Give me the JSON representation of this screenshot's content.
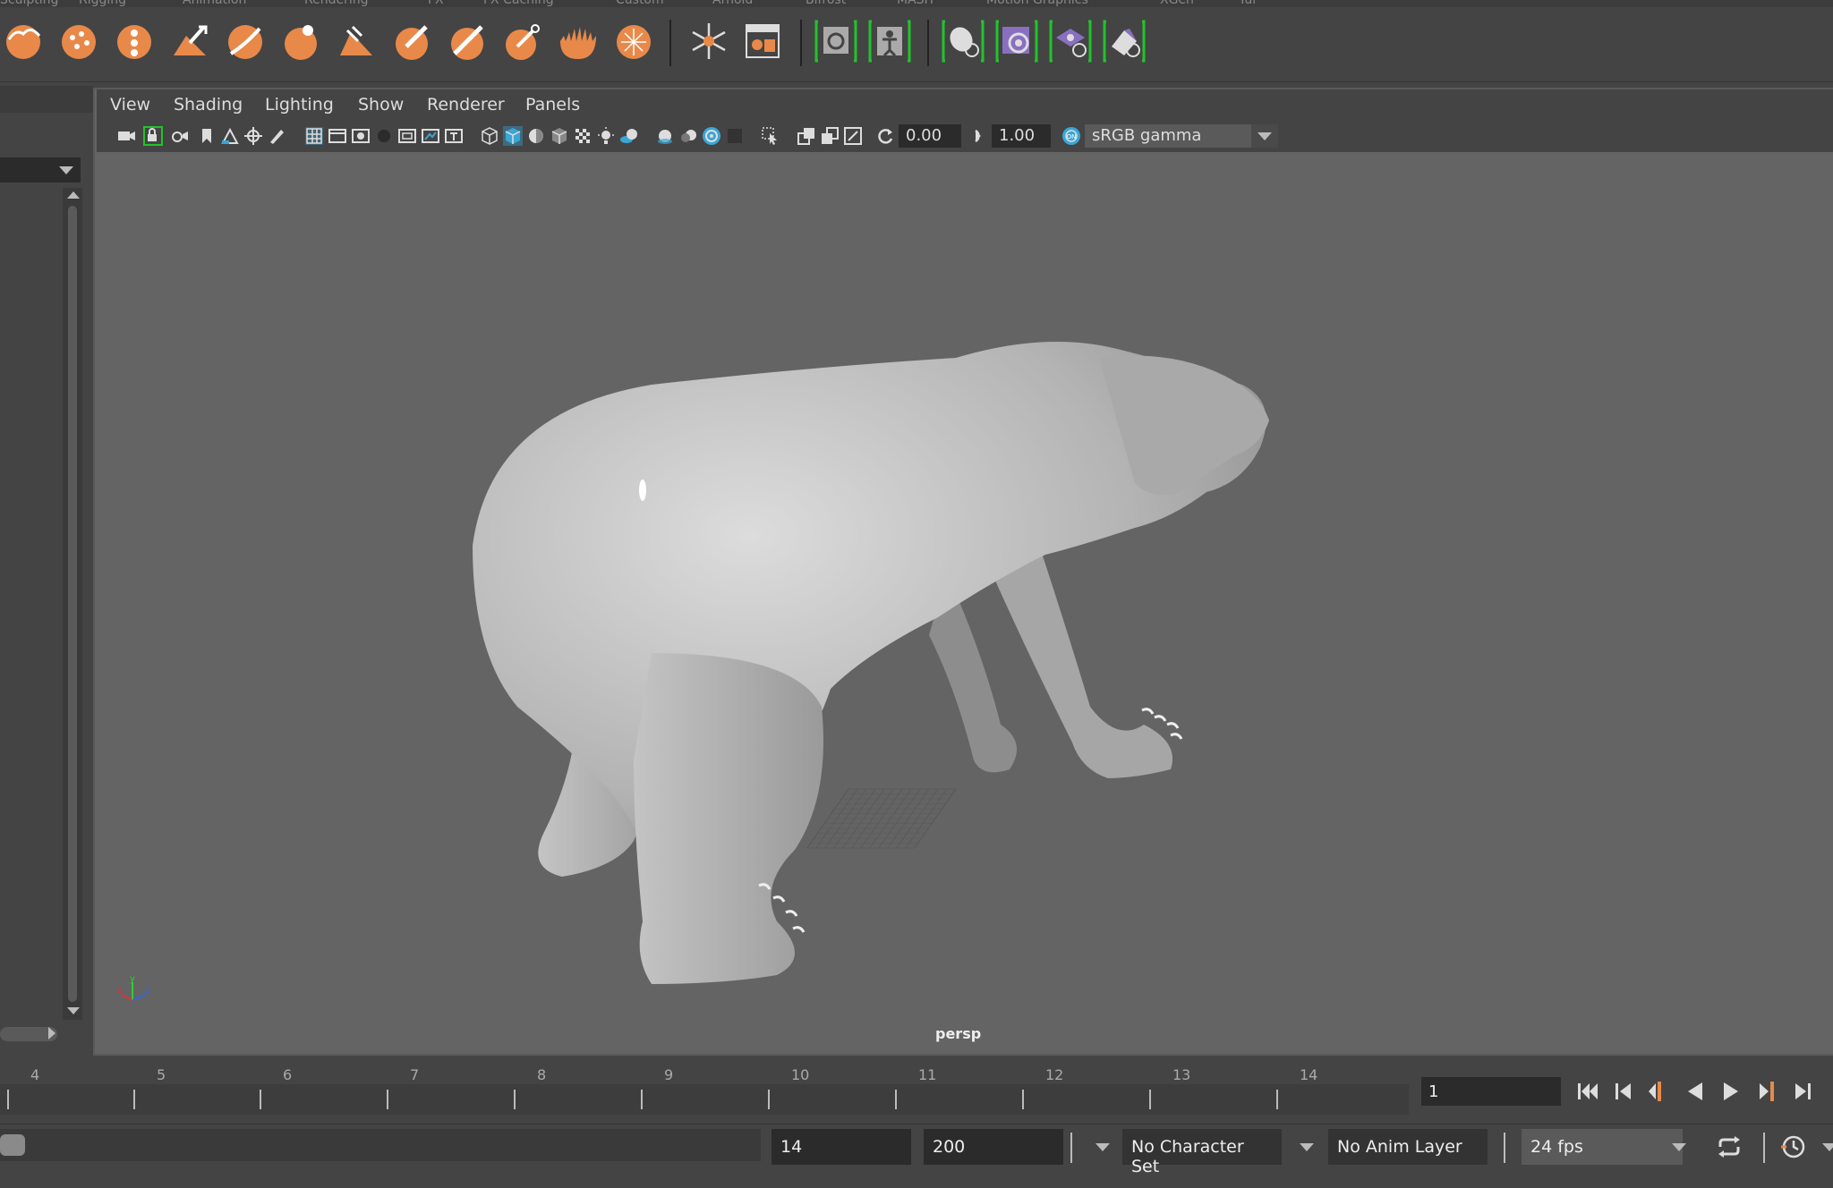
{
  "shelf_tabs": [
    "Sculpting",
    "Rigging",
    "Animation",
    "Rendering",
    "FX",
    "FX Caching",
    "Custom",
    "Arnold",
    "Bifrost",
    "MASH",
    "Motion Graphics",
    "XGen",
    "Tur"
  ],
  "viewport_menu": {
    "view": "View",
    "shading": "Shading",
    "lighting": "Lighting",
    "show": "Show",
    "renderer": "Renderer",
    "panels": "Panels"
  },
  "viewport_toolbar": {
    "exposure": "0.00",
    "gamma": "1.00",
    "color_space": "sRGB gamma"
  },
  "viewport": {
    "camera": "persp",
    "axis": {
      "x": "x",
      "y": "y",
      "z": "z"
    }
  },
  "timeline": {
    "ticks": [
      "4",
      "5",
      "6",
      "7",
      "8",
      "9",
      "10",
      "11",
      "12",
      "13",
      "14"
    ],
    "current_frame": "1"
  },
  "range": {
    "end": "14",
    "anim_end": "200",
    "character_set": "No Character Set",
    "anim_layer": "No Anim Layer",
    "fps": "24 fps"
  },
  "colors": {
    "shelf_orange": "#e8894a",
    "shelf_purple": "#8a6fc0",
    "green_bracket": "#21c32b",
    "active_blue": "#3aa6d6"
  }
}
